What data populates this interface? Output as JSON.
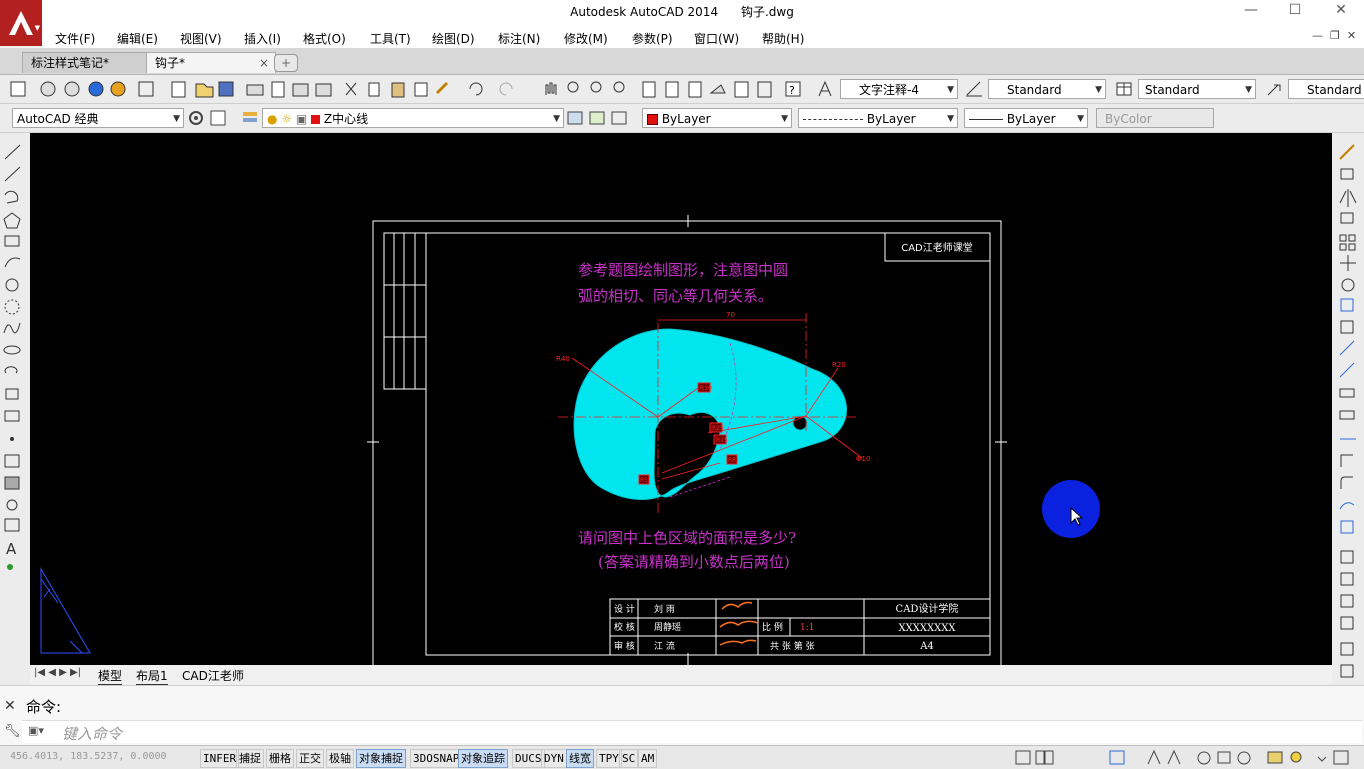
{
  "app": {
    "title": "Autodesk AutoCAD 2014",
    "filename": "钩子.dwg",
    "logo": "A"
  },
  "window_controls": {
    "minimize": "—",
    "maximize": "☐",
    "close": "✕"
  },
  "menu": [
    "文件(F)",
    "编辑(E)",
    "视图(V)",
    "插入(I)",
    "格式(O)",
    "工具(T)",
    "绘图(D)",
    "标注(N)",
    "修改(M)",
    "参数(P)",
    "窗口(W)",
    "帮助(H)"
  ],
  "doc_tabs": [
    {
      "label": "标注样式笔记*",
      "close": "×"
    },
    {
      "label": "钩子*",
      "close": "×"
    }
  ],
  "toolbar": {
    "text_style": "文字注释-4",
    "dim_style": "Standard",
    "table_style": "Standard",
    "mleader_style": "Standard",
    "workspace": "AutoCAD 经典",
    "layer": "Z中心线",
    "color": "ByLayer",
    "linetype": "ByLayer",
    "lineweight": "ByLayer",
    "plotstyle": "ByColor"
  },
  "drawing": {
    "corner_label": "CAD江老师课堂",
    "instruction_line1": "参考题图绘制图形，注意图中圆",
    "instruction_line2": "弧的相切、同心等几何关系。",
    "question_line1": "请问图中上色区域的面积是多少?",
    "question_line2": "(答案请精确到小数点后两位)",
    "dimensions": {
      "width": "70",
      "r_large": "R40",
      "r_small": "R20",
      "dia": "Φ10",
      "d1": "R10",
      "d2": "R25",
      "d3": "R15",
      "d4": "R8",
      "d5": "R5"
    },
    "title_block": {
      "r1c1": "设  计",
      "r1c2": "刘 雨",
      "r2c1": "校  核",
      "r2c2": "周静瑶",
      "r3c1": "审  核",
      "r3c2": "江 流",
      "scale_label": "比  例",
      "scale_value": "1:1",
      "sheet_label": "共  张  第  张",
      "school": "CAD设计学院",
      "drawing_no": "XXXXXXXX",
      "size": "A4"
    },
    "fill_color": "#00e5ee",
    "dim_color": "#ff2020",
    "text_color": "#c832c8"
  },
  "layout_tabs": [
    "模型",
    "布局1",
    "CAD江老师"
  ],
  "command": {
    "history": "命令:",
    "placeholder": "键入命令"
  },
  "status": {
    "coords": "456.4013, 183.5237, 0.0000",
    "toggles": [
      {
        "label": "INFER",
        "on": false
      },
      {
        "label": "捕捉",
        "on": false
      },
      {
        "label": "栅格",
        "on": false
      },
      {
        "label": "正交",
        "on": false
      },
      {
        "label": "极轴",
        "on": false
      },
      {
        "label": "对象捕捉",
        "on": true
      },
      {
        "label": "3DOSNAP",
        "on": false
      },
      {
        "label": "对象追踪",
        "on": true
      },
      {
        "label": "DUCS",
        "on": false
      },
      {
        "label": "DYN",
        "on": false
      },
      {
        "label": "线宽",
        "on": true
      },
      {
        "label": "TPY",
        "on": false
      },
      {
        "label": "SC",
        "on": false
      },
      {
        "label": "AM",
        "on": false
      }
    ]
  }
}
